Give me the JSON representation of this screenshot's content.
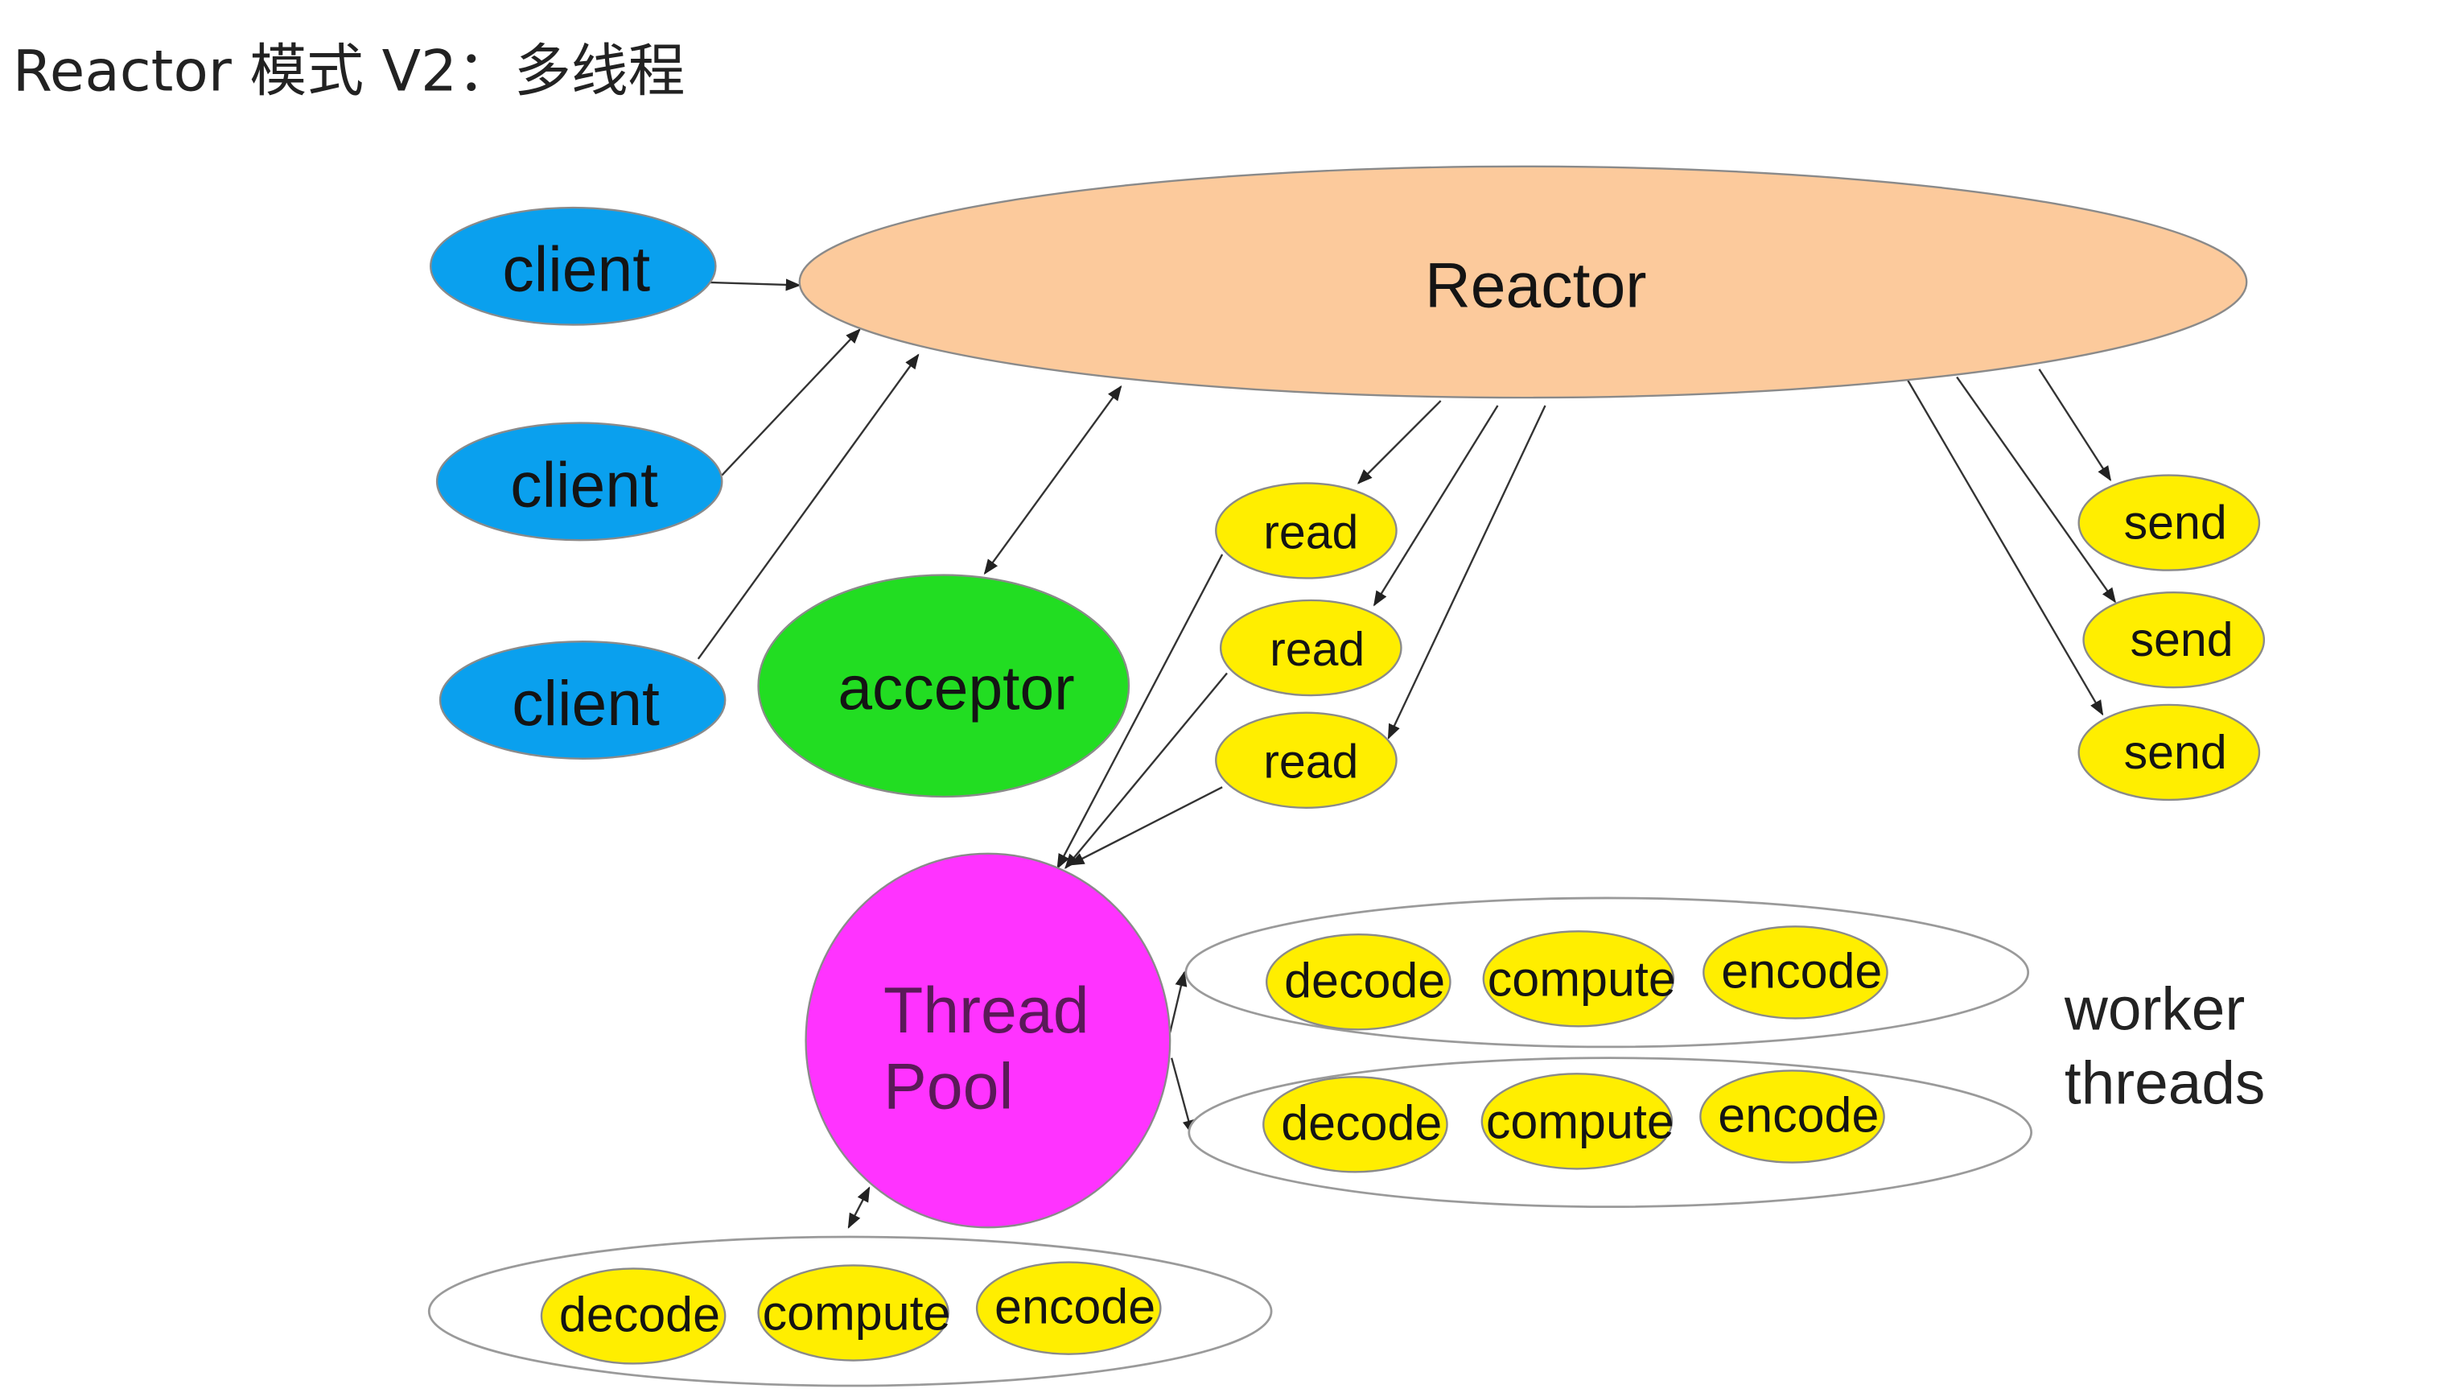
{
  "title": "Reactor 模式 V2：多线程",
  "colors": {
    "client": "#0aa0ee",
    "reactor": "#fcca9c",
    "acceptor": "#22dd22",
    "task": "#ffee00",
    "thread_pool": "#ff33ff"
  },
  "reactor": {
    "label": "Reactor"
  },
  "clients": [
    {
      "label": "client"
    },
    {
      "label": "client"
    },
    {
      "label": "client"
    }
  ],
  "acceptor": {
    "label": "acceptor"
  },
  "reads": [
    {
      "label": "read"
    },
    {
      "label": "read"
    },
    {
      "label": "read"
    }
  ],
  "sends": [
    {
      "label": "send"
    },
    {
      "label": "send"
    },
    {
      "label": "send"
    }
  ],
  "thread_pool": {
    "line1": "Thread",
    "line2": "Pool"
  },
  "worker_groups": [
    {
      "tasks": [
        "decode",
        "compute",
        "encode"
      ]
    },
    {
      "tasks": [
        "decode",
        "compute",
        "encode"
      ]
    },
    {
      "tasks": [
        "decode",
        "compute",
        "encode"
      ]
    }
  ],
  "worker_threads_label": {
    "line1": "worker",
    "line2": "threads"
  }
}
